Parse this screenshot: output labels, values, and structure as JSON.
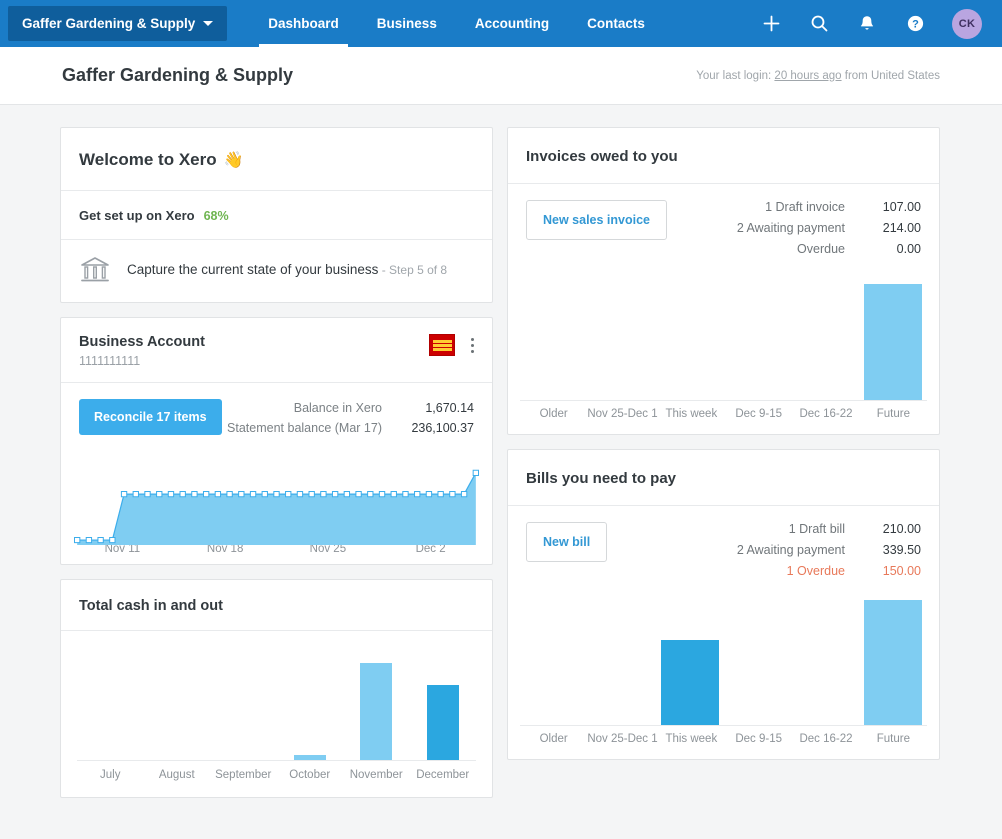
{
  "topnav": {
    "org_name": "Gaffer Gardening & Supply",
    "links": [
      {
        "label": "Dashboard",
        "active": true
      },
      {
        "label": "Business",
        "active": false
      },
      {
        "label": "Accounting",
        "active": false
      },
      {
        "label": "Contacts",
        "active": false
      }
    ],
    "icons": [
      "plus-icon",
      "search-icon",
      "bell-icon",
      "help-icon"
    ],
    "avatar_initials": "CK",
    "avatar_color": "#b9a5e0",
    "bg_color": "#1a7cc7"
  },
  "subheader": {
    "title": "Gaffer Gardening & Supply",
    "lastlogin_prefix": "Your last login: ",
    "lastlogin_link": "20 hours ago",
    "lastlogin_suffix": " from United States"
  },
  "welcome": {
    "title": "Welcome to Xero",
    "wave": "👋",
    "setup_label": "Get set up on Xero",
    "setup_percent": "68%",
    "setup_percent_color": "#6fb551",
    "step_text": "Capture the current state of your business",
    "step_sub": " - Step 5 of 8",
    "step_icon": "bank-icon"
  },
  "bank_account": {
    "name": "Business Account",
    "number": "1111111111",
    "logo_name": "wells-fargo-logo",
    "menu_name": "kebab-menu",
    "reconcile_label": "Reconcile 17 items",
    "balance_rows": [
      {
        "label": "Balance in Xero",
        "value": "1,670.14"
      },
      {
        "label": "Statement balance (Mar 17)",
        "value": "236,100.37"
      }
    ]
  },
  "invoices": {
    "title": "Invoices owed to you",
    "button_label": "New sales invoice",
    "stats": [
      {
        "label": "1 Draft invoice",
        "value": "107.00",
        "overdue": false
      },
      {
        "label": "2 Awaiting payment",
        "value": "214.00",
        "overdue": false
      },
      {
        "label": "Overdue",
        "value": "0.00",
        "overdue": false
      }
    ]
  },
  "bills": {
    "title": "Bills you need to pay",
    "button_label": "New bill",
    "stats": [
      {
        "label": "1 Draft bill",
        "value": "210.00",
        "overdue": false
      },
      {
        "label": "2 Awaiting payment",
        "value": "339.50",
        "overdue": false
      },
      {
        "label": "1 Overdue",
        "value": "150.00",
        "overdue": true
      }
    ]
  },
  "cash_card": {
    "title": "Total cash in and out"
  },
  "chart_data": [
    {
      "id": "bank_balance_area",
      "type": "area",
      "title": "Business Account balance",
      "xlabel": "",
      "ylabel": "",
      "tick_labels": [
        "Nov 11",
        "Nov 18",
        "Nov 25",
        "Dec 2"
      ],
      "grid": false,
      "legend": "none",
      "line_color": "#3cadeb",
      "fill_color": "#7fcdf2",
      "marker": "open-square",
      "x": [
        0,
        1,
        2,
        3,
        4,
        5,
        6,
        7,
        8,
        9,
        10,
        11,
        12,
        13,
        14,
        15,
        16,
        17,
        18,
        19,
        20,
        21,
        22,
        23,
        24,
        25,
        26,
        27,
        28,
        29,
        30,
        31,
        32,
        33,
        34
      ],
      "values": [
        6,
        6,
        6,
        6,
        62,
        62,
        62,
        62,
        62,
        62,
        62,
        62,
        62,
        62,
        62,
        62,
        62,
        62,
        62,
        62,
        62,
        62,
        62,
        62,
        62,
        62,
        62,
        62,
        62,
        62,
        62,
        62,
        62,
        62,
        88
      ],
      "ylim": [
        0,
        100
      ]
    },
    {
      "id": "total_cash_in_out",
      "type": "bar",
      "title": "Total cash in and out",
      "categories": [
        "July",
        "August",
        "September",
        "October",
        "November",
        "December"
      ],
      "values": [
        0,
        0,
        0,
        5,
        97,
        75
      ],
      "colors": [
        "#7fcdf2",
        "#7fcdf2",
        "#7fcdf2",
        "#7fcdf2",
        "#7fcdf2",
        "#2ba7e0"
      ],
      "xlabel": "",
      "ylabel": "",
      "ylim": [
        0,
        124
      ],
      "grid": false,
      "legend": "none"
    },
    {
      "id": "invoices_owed_to_you",
      "type": "bar",
      "title": "Invoices owed to you",
      "categories": [
        "Older",
        "Nov 25-Dec 1",
        "This week",
        "Dec 9-15",
        "Dec 16-22",
        "Future"
      ],
      "values": [
        0,
        0,
        0,
        0,
        0,
        107
      ],
      "colors": [
        "#7fcdf2",
        "#7fcdf2",
        "#7fcdf2",
        "#7fcdf2",
        "#7fcdf2",
        "#7fcdf2"
      ],
      "xlabel": "",
      "ylabel": "",
      "ylim": [
        0,
        120
      ],
      "grid": false,
      "legend": "none"
    },
    {
      "id": "bills_you_need_to_pay",
      "type": "bar",
      "title": "Bills you need to pay",
      "categories": [
        "Older",
        "Nov 25-Dec 1",
        "This week",
        "Dec 9-15",
        "Dec 16-22",
        "Future"
      ],
      "values": [
        0,
        0,
        82,
        0,
        0,
        120
      ],
      "colors": [
        "#7fcdf2",
        "#7fcdf2",
        "#2ba7e0",
        "#7fcdf2",
        "#7fcdf2",
        "#7fcdf2"
      ],
      "xlabel": "",
      "ylabel": "",
      "ylim": [
        0,
        128
      ],
      "grid": false,
      "legend": "none"
    }
  ]
}
